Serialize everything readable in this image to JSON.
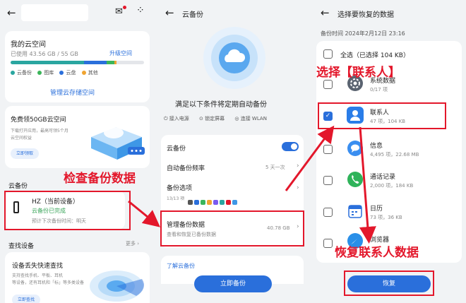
{
  "panel1": {
    "my_space": {
      "title": "我的云空间",
      "used": "已使用 43.56 GB / 55 GB",
      "upgrade": "升级空间",
      "legend": [
        {
          "label": "云备份",
          "color": "#2aa6a0"
        },
        {
          "label": "图库",
          "color": "#3bb55a"
        },
        {
          "label": "云盘",
          "color": "#2a6fdb"
        },
        {
          "label": "其他",
          "color": "#f0a430"
        }
      ],
      "manage": "管理云存储空间",
      "usage": [
        {
          "frac": 0.55,
          "color": "#2aa6a0"
        },
        {
          "frac": 0.17,
          "color": "#2a6fdb"
        },
        {
          "frac": 0.06,
          "color": "#3bb55a"
        },
        {
          "frac": 0.015,
          "color": "#f0a430"
        }
      ]
    },
    "promo": {
      "title": "免费领50GB云空间",
      "desc1": "下载打开应用，最高可领5个月",
      "desc2": "云空间权益",
      "btn": "立即领取"
    },
    "backup_section": "云备份",
    "device": {
      "name": "HZ（当前设备）",
      "status": "云备份已完成",
      "next": "预计下次备份时间：明天"
    },
    "find": {
      "section": "查找设备",
      "more": "更多",
      "title": "设备丢失快速查找",
      "desc1": "支持查找手机、平板、耳机",
      "desc2": "等设备，还有耳机和「标」等多类设备",
      "btn": "立即查找"
    }
  },
  "panel2": {
    "header": "云备份",
    "conditions_title": "满足以下条件将定期自动备份",
    "conditions": [
      "接入电源",
      "锁定屏幕",
      "连接 WLAN"
    ],
    "settings": [
      {
        "label": "云备份"
      },
      {
        "label": "自动备份频率",
        "value": "5 天一次"
      },
      {
        "label": "备份选项",
        "sub": "13/13 项"
      }
    ],
    "manage": {
      "title": "管理备份数据",
      "desc": "查看和恢复已备份数据",
      "size": "40.78 GB"
    },
    "learn": "了解云备份",
    "action": "立即备份"
  },
  "panel3": {
    "header": "选择要恢复的数据",
    "backup_time": "备份时间  2024年2月12日  23:16",
    "select_all": "全选（已选择 104 KB）",
    "items": [
      {
        "name": "系统数据",
        "meta": "0/17 项",
        "checked": false,
        "icon": "gear-icon"
      },
      {
        "name": "联系人",
        "meta": "47 项，104 KB",
        "checked": true,
        "icon": "contacts-icon"
      },
      {
        "name": "信息",
        "meta": "4,495 项，22.68 MB",
        "checked": false,
        "icon": "message-icon"
      },
      {
        "name": "通话记录",
        "meta": "2,000 项，184 KB",
        "checked": false,
        "icon": "phone-icon"
      },
      {
        "name": "日历",
        "meta": "73 项，36 KB",
        "checked": false,
        "icon": "calendar-icon"
      },
      {
        "name": "浏览器",
        "meta": "",
        "checked": false,
        "icon": "browser-icon"
      }
    ],
    "restore": "恢复"
  },
  "annotations": {
    "check": "检查备份数据",
    "select": "选择【联系人】",
    "restore": "恢复联系人数据",
    "accent": "#e3172b"
  }
}
